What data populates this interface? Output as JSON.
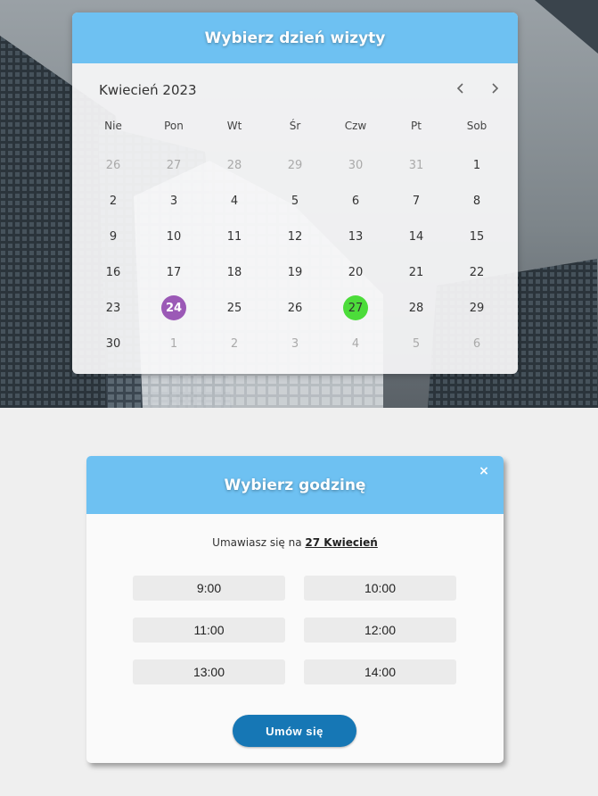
{
  "calendar": {
    "title": "Wybierz dzień wizyty",
    "month_label": "Kwiecień 2023",
    "prev_icon": "chevron-left-icon",
    "next_icon": "chevron-right-icon",
    "weekdays": [
      "Nie",
      "Pon",
      "Wt",
      "Śr",
      "Czw",
      "Pt",
      "Sob"
    ],
    "weeks": [
      [
        {
          "label": "26",
          "muted": true
        },
        {
          "label": "27",
          "muted": true
        },
        {
          "label": "28",
          "muted": true
        },
        {
          "label": "29",
          "muted": true
        },
        {
          "label": "30",
          "muted": true
        },
        {
          "label": "31",
          "muted": true
        },
        {
          "label": "1"
        }
      ],
      [
        {
          "label": "2"
        },
        {
          "label": "3"
        },
        {
          "label": "4"
        },
        {
          "label": "5"
        },
        {
          "label": "6"
        },
        {
          "label": "7"
        },
        {
          "label": "8"
        }
      ],
      [
        {
          "label": "9"
        },
        {
          "label": "10"
        },
        {
          "label": "11"
        },
        {
          "label": "12"
        },
        {
          "label": "13"
        },
        {
          "label": "14"
        },
        {
          "label": "15"
        }
      ],
      [
        {
          "label": "16"
        },
        {
          "label": "17"
        },
        {
          "label": "18"
        },
        {
          "label": "19"
        },
        {
          "label": "20"
        },
        {
          "label": "21"
        },
        {
          "label": "22"
        }
      ],
      [
        {
          "label": "23"
        },
        {
          "label": "24",
          "highlight": "purple"
        },
        {
          "label": "25"
        },
        {
          "label": "26"
        },
        {
          "label": "27",
          "highlight": "green"
        },
        {
          "label": "28"
        },
        {
          "label": "29"
        }
      ],
      [
        {
          "label": "30"
        },
        {
          "label": "1",
          "muted": true
        },
        {
          "label": "2",
          "muted": true
        },
        {
          "label": "3",
          "muted": true
        },
        {
          "label": "4",
          "muted": true
        },
        {
          "label": "5",
          "muted": true
        },
        {
          "label": "6",
          "muted": true
        }
      ]
    ]
  },
  "time_modal": {
    "title": "Wybierz godzinę",
    "close_icon": "close-icon",
    "close_label": "×",
    "info_prefix": "Umawiasz się na ",
    "info_date": "27 Kwiecień",
    "slots": [
      "9:00",
      "10:00",
      "11:00",
      "12:00",
      "13:00",
      "14:00"
    ],
    "submit_label": "Umów się"
  },
  "colors": {
    "header_blue": "#6ec1f2",
    "today_purple": "#9b59b6",
    "selected_green": "#4cdc3a",
    "submit_blue": "#1677b5"
  }
}
